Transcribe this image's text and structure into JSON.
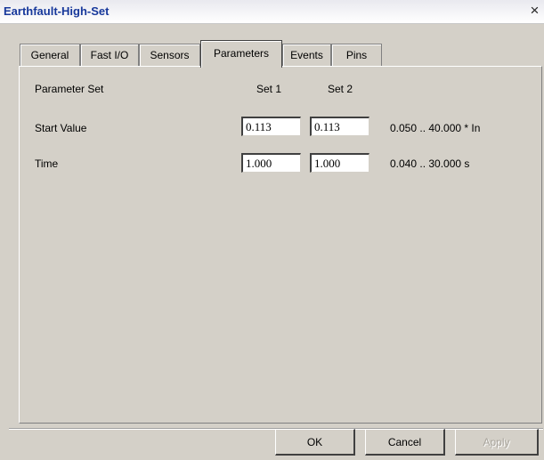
{
  "window": {
    "title": "Earthfault-High-Set",
    "close_glyph": "×"
  },
  "tabs": [
    {
      "label": "General",
      "active": false
    },
    {
      "label": "Fast I/O",
      "active": false
    },
    {
      "label": "Sensors",
      "active": false
    },
    {
      "label": "Parameters",
      "active": true
    },
    {
      "label": "Events",
      "active": false
    },
    {
      "label": "Pins",
      "active": false
    }
  ],
  "parameters": {
    "header_label": "Parameter Set",
    "set1_label": "Set 1",
    "set2_label": "Set 2",
    "rows": [
      {
        "label": "Start Value",
        "set1": "0.113",
        "set2": "0.113",
        "range": "0.050 .. 40.000 * In"
      },
      {
        "label": "Time",
        "set1": "1.000",
        "set2": "1.000",
        "range": "0.040 .. 30.000 s"
      }
    ]
  },
  "buttons": {
    "ok": "OK",
    "cancel": "Cancel",
    "apply": "Apply",
    "apply_enabled": false
  }
}
